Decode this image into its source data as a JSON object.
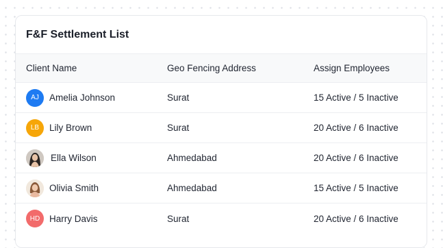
{
  "card": {
    "title": "F&F Settlement List"
  },
  "table": {
    "headers": {
      "client_name": "Client Name",
      "geo_fencing_address": "Geo Fencing Address",
      "assign_employees": "Assign Employees"
    },
    "rows": [
      {
        "avatar_type": "initials",
        "initials": "AJ",
        "avatar_color": "#1E7BF2",
        "name": "Amelia Johnson",
        "address": "Surat",
        "employees": "15 Active / 5 Inactive"
      },
      {
        "avatar_type": "initials",
        "initials": "LB",
        "avatar_color": "#F6A609",
        "name": "Lily Brown",
        "address": "Surat",
        "employees": "20 Active / 6 Inactive"
      },
      {
        "avatar_type": "photo",
        "avatar_icon": "person-photo-icon",
        "name": "Ella Wilson",
        "address": "Ahmedabad",
        "employees": "20 Active / 6 Inactive"
      },
      {
        "avatar_type": "photo",
        "avatar_icon": "person-photo-icon",
        "name": "Olivia Smith",
        "address": "Ahmedabad",
        "employees": "15 Active / 5 Inactive"
      },
      {
        "avatar_type": "initials",
        "initials": "HD",
        "avatar_color": "#F26B6B",
        "name": "Harry Davis",
        "address": "Surat",
        "employees": "20 Active / 6 Inactive"
      }
    ]
  }
}
